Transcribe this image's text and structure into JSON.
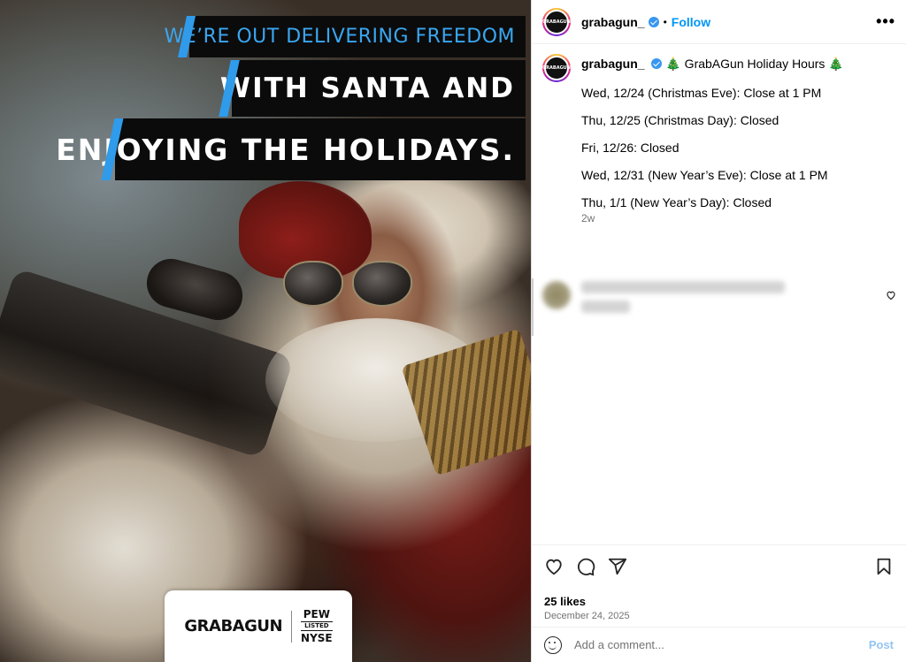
{
  "post_image": {
    "banner_line_1": "WE’RE OUT DELIVERING FREEDOM",
    "banner_line_2": "WITH SANTA AND",
    "banner_line_3": "ENJOYING THE HOLIDAYS.",
    "logo_text": "GRABAGUN",
    "badge_top": "PEW",
    "badge_mid": "LISTED",
    "badge_bottom": "NYSE",
    "accent_color": "#2f9bea"
  },
  "header": {
    "username": "grabagun_",
    "dot": "•",
    "follow_label": "Follow",
    "more_label": "•••",
    "avatar_text": "GRABAGUN"
  },
  "caption": {
    "username": "grabagun_",
    "title": "🎄 GrabAGun Holiday Hours 🎄",
    "lines": [
      "Wed, 12/24 (Christmas Eve): Close at 1 PM",
      "Thu, 12/25 (Christmas Day): Closed",
      "Fri, 12/26: Closed",
      "Wed, 12/31 (New Year’s Eve): Close at 1 PM",
      "Thu, 1/1 (New Year’s Day): Closed"
    ],
    "time": "2w"
  },
  "actions": {
    "likes": "25 likes",
    "date": "December 24, 2025"
  },
  "add_comment": {
    "placeholder": "Add a comment...",
    "post_label": "Post"
  },
  "icons": [
    "heart-icon",
    "comment-icon",
    "share-icon",
    "bookmark-icon",
    "emoji-icon",
    "verified-icon",
    "more-icon"
  ],
  "colors": {
    "link_blue": "#0095f6",
    "verified_blue": "#3897f0",
    "post_disabled": "#93c5f5"
  }
}
